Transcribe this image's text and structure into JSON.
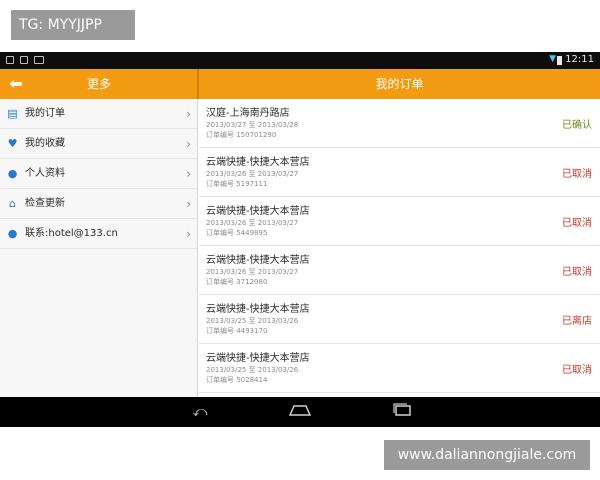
{
  "watermark_tl": "TG: MYYJJPP",
  "watermark_br": "www.daliannongjiale.com",
  "status": {
    "time": "12:11"
  },
  "appbar": {
    "left_title": "更多",
    "right_title": "我的订单",
    "back_icon": "arrow-left-icon"
  },
  "menu": [
    {
      "label": "我的订单",
      "icon": "order-list-icon",
      "glyph": "▤"
    },
    {
      "label": "我的收藏",
      "icon": "heart-icon",
      "glyph": "♥"
    },
    {
      "label": "个人资料",
      "icon": "user-icon",
      "glyph": "●"
    },
    {
      "label": "检查更新",
      "icon": "home-icon",
      "glyph": "⌂"
    },
    {
      "label": "联系:hotel@133.cn",
      "icon": "chat-icon",
      "glyph": "●"
    }
  ],
  "orders": [
    {
      "name": "汉庭-上海南丹路店",
      "dates": "2013/03/27 至 2013/03/28",
      "number": "订单编号 150701290",
      "status": "已确认",
      "status_color": "#6a8a1f"
    },
    {
      "name": "云端快捷-快捷大本营店",
      "dates": "2013/03/26 至 2013/03/27",
      "number": "订单编号 5197111",
      "status": "已取消",
      "status_color": "#c0392b"
    },
    {
      "name": "云端快捷-快捷大本营店",
      "dates": "2013/03/26 至 2013/03/27",
      "number": "订单编号 5449895",
      "status": "已取消",
      "status_color": "#c0392b"
    },
    {
      "name": "云端快捷-快捷大本营店",
      "dates": "2013/03/26 至 2013/03/27",
      "number": "订单编号 3712080",
      "status": "已取消",
      "status_color": "#c0392b"
    },
    {
      "name": "云端快捷-快捷大本营店",
      "dates": "2013/03/25 至 2013/03/26",
      "number": "订单编号 4493170",
      "status": "已离店",
      "status_color": "#c0392b"
    },
    {
      "name": "云端快捷-快捷大本营店",
      "dates": "2013/03/25 至 2013/03/26",
      "number": "订单编号 5028414",
      "status": "已取消",
      "status_color": "#c0392b"
    }
  ],
  "nav": {
    "back": "back-icon",
    "home": "home-nav-icon",
    "recents": "recents-icon"
  },
  "colors": {
    "accent": "#f39b12",
    "confirmed": "#6a8a1f",
    "cancelled": "#c0392b"
  }
}
